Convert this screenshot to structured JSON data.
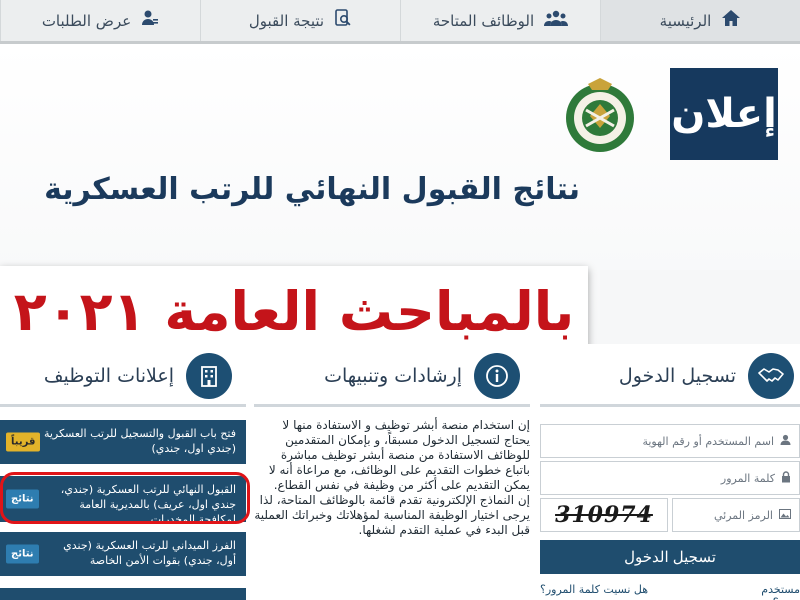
{
  "nav": {
    "items": [
      {
        "label": "عرض الطلبات",
        "icon": "user-list-icon"
      },
      {
        "label": "نتيجة القبول",
        "icon": "result-search-icon"
      },
      {
        "label": "الوظائف المتاحة",
        "icon": "group-users-icon"
      },
      {
        "label": "الرئيسية",
        "icon": "home-icon"
      }
    ]
  },
  "hero": {
    "badge": "إعلان",
    "title": "نتائج القبول النهائي للرتب العسكرية",
    "subtitle": "بالمباحث العامة ٢٠٢١"
  },
  "sections": {
    "jobs_title": "إعلانات التوظيف",
    "tips_title": "إرشادات وتنبيهات",
    "login_title": "تسجيل الدخول"
  },
  "jobs": [
    {
      "text": "فتح باب القبول والتسجيل للرتب العسكرية (جندي اول، جندي)",
      "badge": "قريباً"
    },
    {
      "text": "القبول النهائي للرتب العسكرية (جندي، جندي اول، عريف) بالمديرية العامة لمكافحة المخدرات",
      "badge": "نتائج"
    },
    {
      "text": "الفرز الميداني للرتب العسكرية (جندي أول، جندي) بقوات الأمن الخاصة",
      "badge": "نتائج"
    }
  ],
  "instructions": {
    "p1": "إن استخدام منصة أبشر توظيف و الاستفادة منها لا يحتاج لتسجيل الدخول مسبقاً، و بإمكان المتقدمين للوظائف الاستفادة من منصة أبشر توظيف مباشرة باتباع خطوات التقديم على الوظائف، مع مراعاة أنه لا يمكن التقديم على أكثر من وظيفة في نفس القطاع.",
    "p2": "إن النماذج الإلكترونية تقدم قائمة بالوظائف المتاحة، لذا يرجى اختيار الوظيفة المناسبة لمؤهلاتك وخبراتك العملية قبل البدء في عملية التقدم لشغلها."
  },
  "login": {
    "username_placeholder": "اسم المستخدم أو رقم الهوية",
    "password_placeholder": "كلمة المرور",
    "captcha_placeholder": "الرمز المرئي",
    "captcha_text": "310974",
    "button": "تسجيل الدخول",
    "new_user": "مستخدم جديد؟",
    "forgot": "هل نسيت كلمة المرور؟"
  },
  "colors": {
    "primary": "#1f4d6e",
    "title": "#1b3a5c",
    "accent_red": "#c4141a",
    "badge_soon": "#e2b32a"
  }
}
